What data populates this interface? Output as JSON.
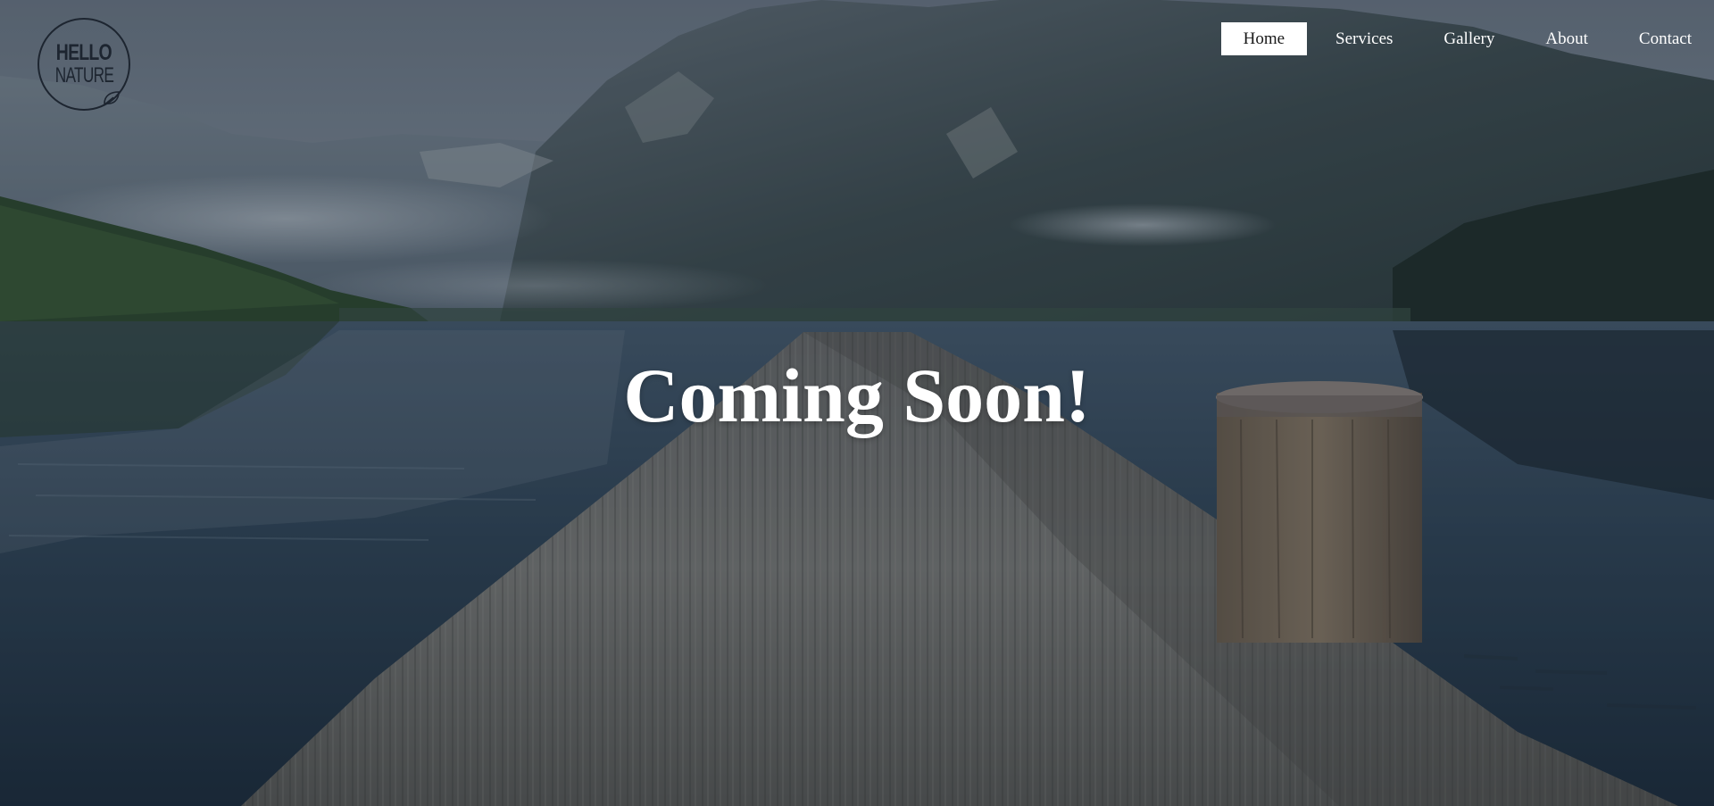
{
  "logo": {
    "line1": "HELLO",
    "line2": "NATURE",
    "icon": "leaf-icon"
  },
  "nav": {
    "items": [
      {
        "label": "Home",
        "active": true
      },
      {
        "label": "Services",
        "active": false
      },
      {
        "label": "Gallery",
        "active": false
      },
      {
        "label": "About",
        "active": false
      },
      {
        "label": "Contact",
        "active": false
      }
    ]
  },
  "hero": {
    "headline": "Coming Soon!",
    "background": "lake-with-wooden-dock-photo"
  }
}
